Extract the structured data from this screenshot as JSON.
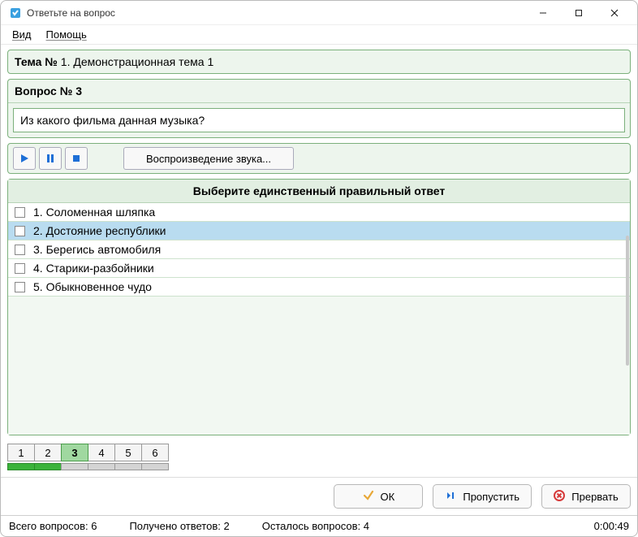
{
  "window": {
    "title": "Ответьте на вопрос"
  },
  "menu": {
    "view": "Вид",
    "help": "Помощь"
  },
  "topic": {
    "prefix": "Тема №",
    "text": " 1. Демонстрационная тема 1"
  },
  "question": {
    "header": "Вопрос № 3",
    "text": "Из какого фильма данная музыка?"
  },
  "audio": {
    "label": "Воспроизведение звука..."
  },
  "answers": {
    "header": "Выберите единственный правильный ответ",
    "items": [
      {
        "label": "1. Соломенная шляпка",
        "selected": false
      },
      {
        "label": "2. Достояние республики",
        "selected": true
      },
      {
        "label": "3. Берегись автомобиля",
        "selected": false
      },
      {
        "label": "4. Старики-разбойники",
        "selected": false
      },
      {
        "label": "5. Обыкновенное чудо",
        "selected": false
      }
    ]
  },
  "nav": {
    "items": [
      {
        "num": "1",
        "done": true,
        "current": false
      },
      {
        "num": "2",
        "done": true,
        "current": false
      },
      {
        "num": "3",
        "done": false,
        "current": true
      },
      {
        "num": "4",
        "done": false,
        "current": false
      },
      {
        "num": "5",
        "done": false,
        "current": false
      },
      {
        "num": "6",
        "done": false,
        "current": false
      }
    ]
  },
  "actions": {
    "ok": "ОК",
    "skip": "Пропустить",
    "abort": "Прервать"
  },
  "status": {
    "total": "Всего вопросов: 6",
    "answered": "Получено ответов: 2",
    "remaining": "Осталось вопросов: 4",
    "time": "0:00:49"
  }
}
